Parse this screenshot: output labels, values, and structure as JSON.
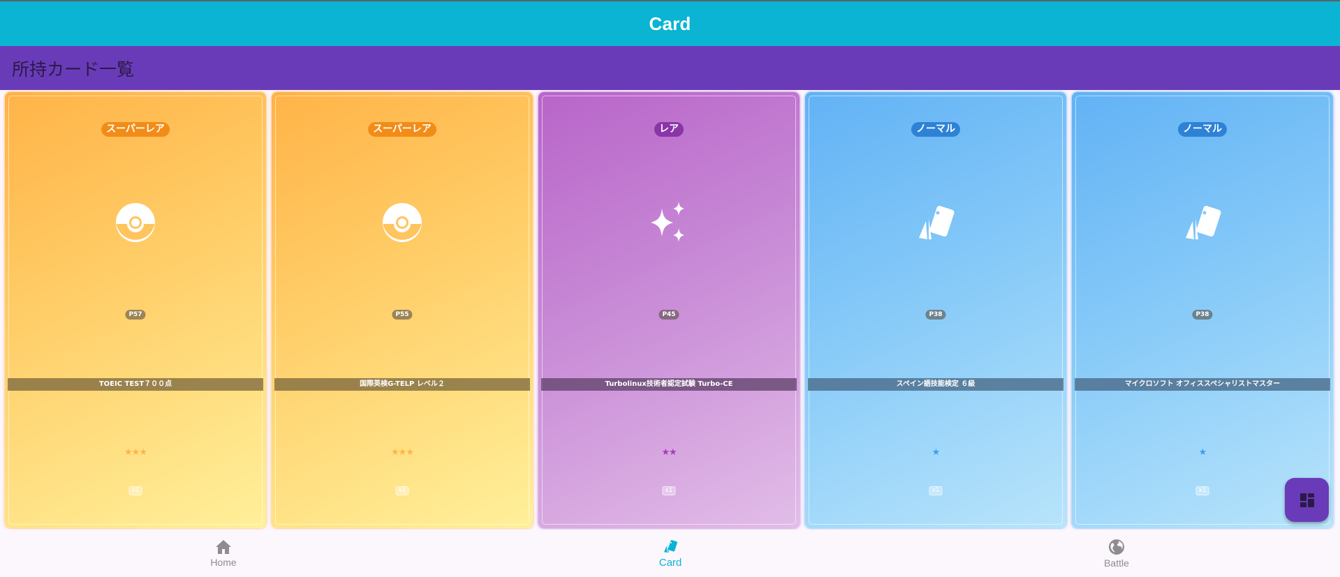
{
  "appbar": {
    "title": "Card"
  },
  "subbar": {
    "title": "所持カード一覧"
  },
  "cards": [
    {
      "rarity": "スーパーレア",
      "icon": "pokeball-icon",
      "power": "P57",
      "name": "TOEIC TEST７００点",
      "stars": "★★★",
      "count": "x1"
    },
    {
      "rarity": "スーパーレア",
      "icon": "pokeball-icon",
      "power": "P55",
      "name": "国際英検G-TELP レベル２",
      "stars": "★★★",
      "count": "x1"
    },
    {
      "rarity": "レア",
      "icon": "sparkles-icon",
      "power": "P45",
      "name": "Turbolinux技術者認定試験 Turbo-CE",
      "stars": "★★",
      "count": "x1"
    },
    {
      "rarity": "ノーマル",
      "icon": "cards-icon",
      "power": "P38",
      "name": "スペイン語技能検定 ６級",
      "stars": "★",
      "count": "x1"
    },
    {
      "rarity": "ノーマル",
      "icon": "cards-icon",
      "power": "P38",
      "name": "マイクロソフト オフィススペシャリストマスター",
      "stars": "★",
      "count": "x1"
    }
  ],
  "nav": {
    "home": "Home",
    "card": "Card",
    "battle": "Battle"
  },
  "colors": {
    "appbar": "#0ab4d2",
    "subbar": "#6a3bb8",
    "super_rare": "#f28c18",
    "rare": "#8a35a8",
    "normal": "#2e82d6"
  }
}
